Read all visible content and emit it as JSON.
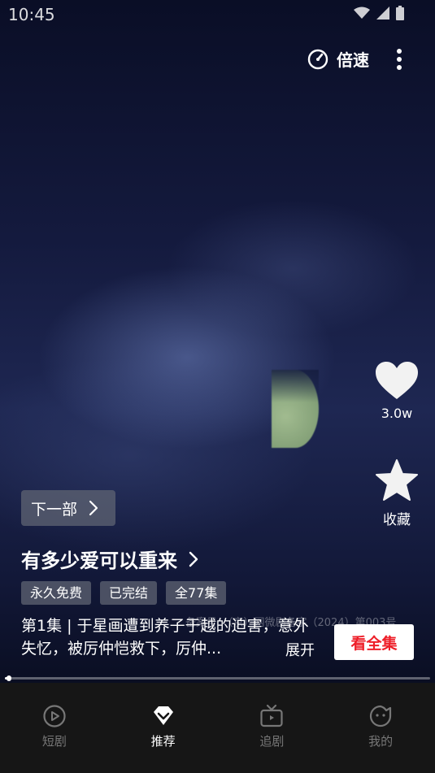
{
  "status_bar": {
    "time": "10:45"
  },
  "player": {
    "speed_label": "倍速",
    "like_count": "3.0w",
    "favorite_label": "收藏",
    "next_label": "下一部",
    "title": "有多少爱可以重来",
    "tags": [
      "永久免费",
      "已完结",
      "全77集"
    ],
    "license": "备案号：（京）网微剧备字（2024）第003号",
    "description": "第1集 | 于星画遭到养子于越的迫害，意外失忆，被厉仲恺救下，厉仲...",
    "expand_label": "展开",
    "watch_all_label": "看全集",
    "progress": 0.01
  },
  "bottom_nav": [
    {
      "label": "短剧",
      "icon": "play-circle-icon",
      "active": false
    },
    {
      "label": "推荐",
      "icon": "diamond-icon",
      "active": true
    },
    {
      "label": "追剧",
      "icon": "tv-icon",
      "active": false
    },
    {
      "label": "我的",
      "icon": "face-icon",
      "active": false
    }
  ],
  "colors": {
    "accent": "#ee1f29",
    "nav_bg": "#161616"
  }
}
